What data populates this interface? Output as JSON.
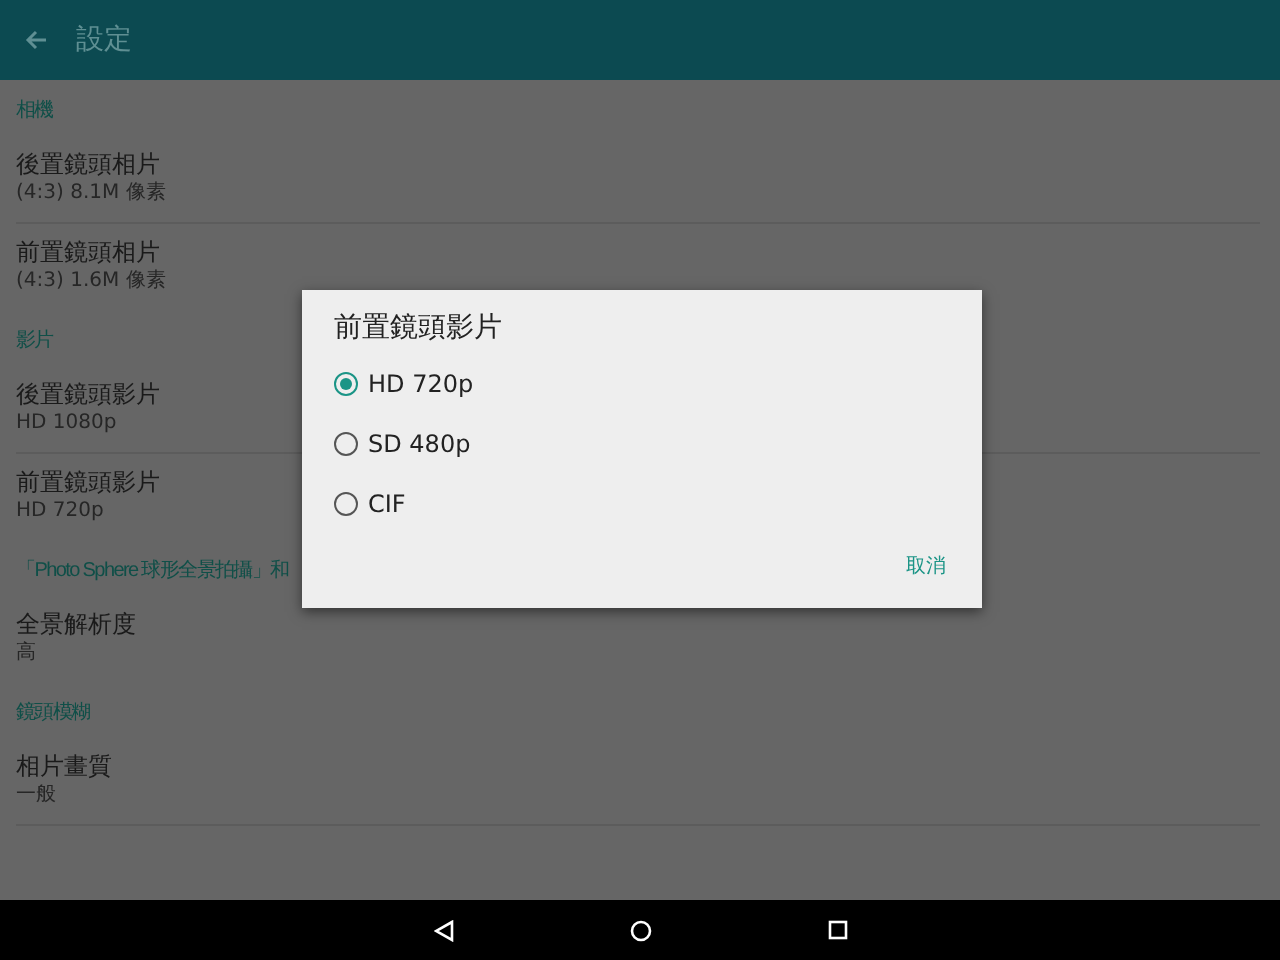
{
  "app_bar": {
    "title": "設定"
  },
  "sections": [
    {
      "header": "相機",
      "items": [
        {
          "title": "後置鏡頭相片",
          "value": "(4:3) 8.1M 像素"
        },
        {
          "title": "前置鏡頭相片",
          "value": "(4:3) 1.6M 像素"
        }
      ]
    },
    {
      "header": "影片",
      "items": [
        {
          "title": "後置鏡頭影片",
          "value": "HD 1080p"
        },
        {
          "title": "前置鏡頭影片",
          "value": "HD 720p"
        }
      ]
    },
    {
      "header": "「Photo Sphere 球形全景拍攝」和",
      "items": [
        {
          "title": "全景解析度",
          "value": "高"
        }
      ]
    },
    {
      "header": "鏡頭模糊",
      "items": [
        {
          "title": "相片畫質",
          "value": "一般"
        }
      ]
    }
  ],
  "dialog": {
    "title": "前置鏡頭影片",
    "options": [
      {
        "label": "HD 720p",
        "selected": true
      },
      {
        "label": "SD 480p",
        "selected": false
      },
      {
        "label": "CIF",
        "selected": false
      }
    ],
    "cancel": "取消"
  }
}
